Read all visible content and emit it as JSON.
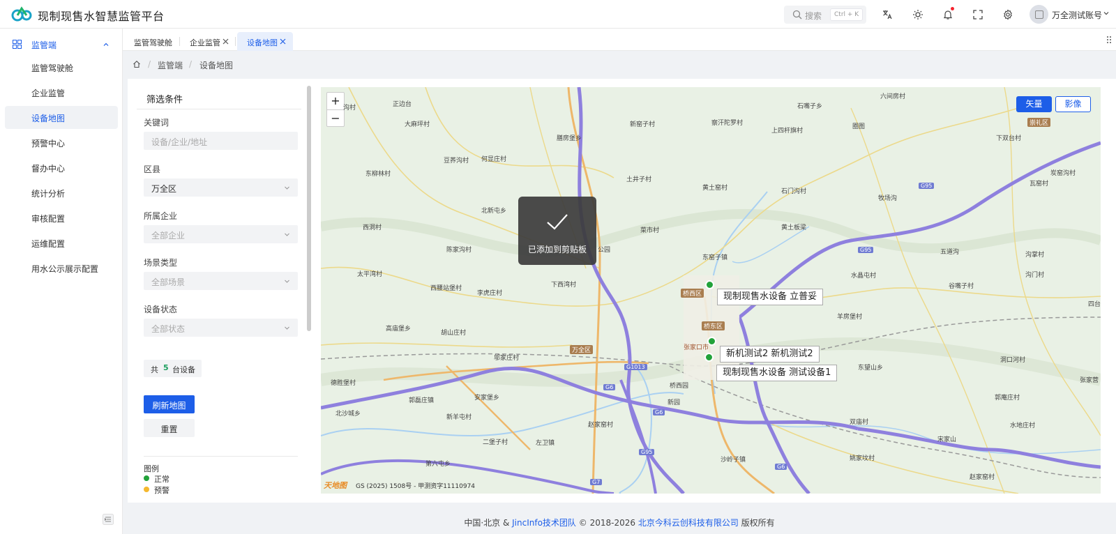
{
  "app": {
    "title": "现制现售水智慧监管平台"
  },
  "header": {
    "search_label": "搜索",
    "search_shortcut": "Ctrl + K",
    "user_name": "万全测试账号"
  },
  "sidebar": {
    "group_label": "监管端",
    "items": [
      {
        "label": "监管驾驶舱"
      },
      {
        "label": "企业监管"
      },
      {
        "label": "设备地图"
      },
      {
        "label": "预警中心"
      },
      {
        "label": "督办中心"
      },
      {
        "label": "统计分析"
      },
      {
        "label": "审核配置"
      },
      {
        "label": "运维配置"
      },
      {
        "label": "用水公示展示配置"
      }
    ],
    "active_index": 2
  },
  "tabs": [
    {
      "label": "监管驾驶舱",
      "closable": false
    },
    {
      "label": "企业监管",
      "closable": true
    },
    {
      "label": "设备地图",
      "closable": true,
      "active": true
    }
  ],
  "breadcrumb": {
    "items": [
      "监管端",
      "设备地图"
    ]
  },
  "filter": {
    "title": "筛选条件",
    "keyword": {
      "label": "关键词",
      "placeholder": "设备/企业/地址",
      "value": ""
    },
    "district": {
      "label": "区县",
      "value": "万全区"
    },
    "company": {
      "label": "所属企业",
      "placeholder": "全部企业"
    },
    "scene": {
      "label": "场景类型",
      "placeholder": "全部场景"
    },
    "status": {
      "label": "设备状态",
      "placeholder": "全部状态"
    },
    "count": {
      "prefix": "共",
      "value": "5",
      "suffix": "台设备"
    },
    "refresh_button": "刷新地图",
    "reset_button": "重置",
    "legend": {
      "title": "图例",
      "items": [
        {
          "label": "正常",
          "color": "#22a23a"
        },
        {
          "label": "预警",
          "color": "#f5b82e"
        }
      ]
    }
  },
  "map": {
    "zoom_in": "+",
    "zoom_out": "−",
    "layer_vector": "矢量",
    "layer_satellite": "影像",
    "toast": "已添加到剪贴板",
    "devices": [
      {
        "label": "现制现售水设备 立普妥",
        "status": "正常"
      },
      {
        "label": "新机测试2 新机测试2",
        "status": "正常"
      },
      {
        "label": "现制现售水设备 测试设备1",
        "status": "正常"
      }
    ],
    "places": [
      "沟村",
      "正边台",
      "大麻坪村",
      "膳房堡乡",
      "新窑子村",
      "察汗陀罗村",
      "上四杆旗村",
      "圈图",
      "石嘴子乡",
      "六间房村",
      "下双台村",
      "崇礼区",
      "炭窑沟村",
      "豆荞沟村",
      "何显庄村",
      "东柳林村",
      "土井子村",
      "黄土窑村",
      "石门沟村",
      "瓦窑村",
      "牧场沟",
      "北新屯乡",
      "西洞村",
      "菜市村",
      "黄土板梁",
      "陈家沟村",
      "五道沟",
      "沟掌村",
      "东窑子镇",
      "太平湾村",
      "公园",
      "水晶屯村",
      "沟门村",
      "西腰站堡村",
      "下西湾村",
      "李虎庄村",
      "谷嘴子村",
      "四台",
      "羊房堡村",
      "高庙堡乡",
      "胡山庄村",
      "张家口市",
      "东望山乡",
      "洞口河村",
      "郭磊庄镇",
      "安家堡乡",
      "邬家庄村",
      "桥西园",
      "德胜堡村",
      "新园",
      "郭庵庄村",
      "张家营",
      "北沙城乡",
      "新羊屯村",
      "赵家窑村",
      "二堡子村",
      "左卫镇",
      "双庙村",
      "宋家山",
      "水地庄村",
      "第六屯乡",
      "沙岭子镇",
      "姚家坟村",
      "赵家窑村"
    ],
    "districts": [
      "崇礼区",
      "桥西区",
      "桥东区",
      "万全区"
    ],
    "road_shields": [
      "G95",
      "G95",
      "G6",
      "G6",
      "G6",
      "G95",
      "G7",
      "G1013"
    ],
    "tianditu": "天地图",
    "gs_number": "GS (2025) 1508号 - 甲测资字11110974"
  },
  "footer": {
    "prefix": "中国·北京 &",
    "team": "JincInfo技术团队",
    "years": "© 2018-2026",
    "company": "北京今科云创科技有限公司",
    "suffix": "版权所有"
  }
}
